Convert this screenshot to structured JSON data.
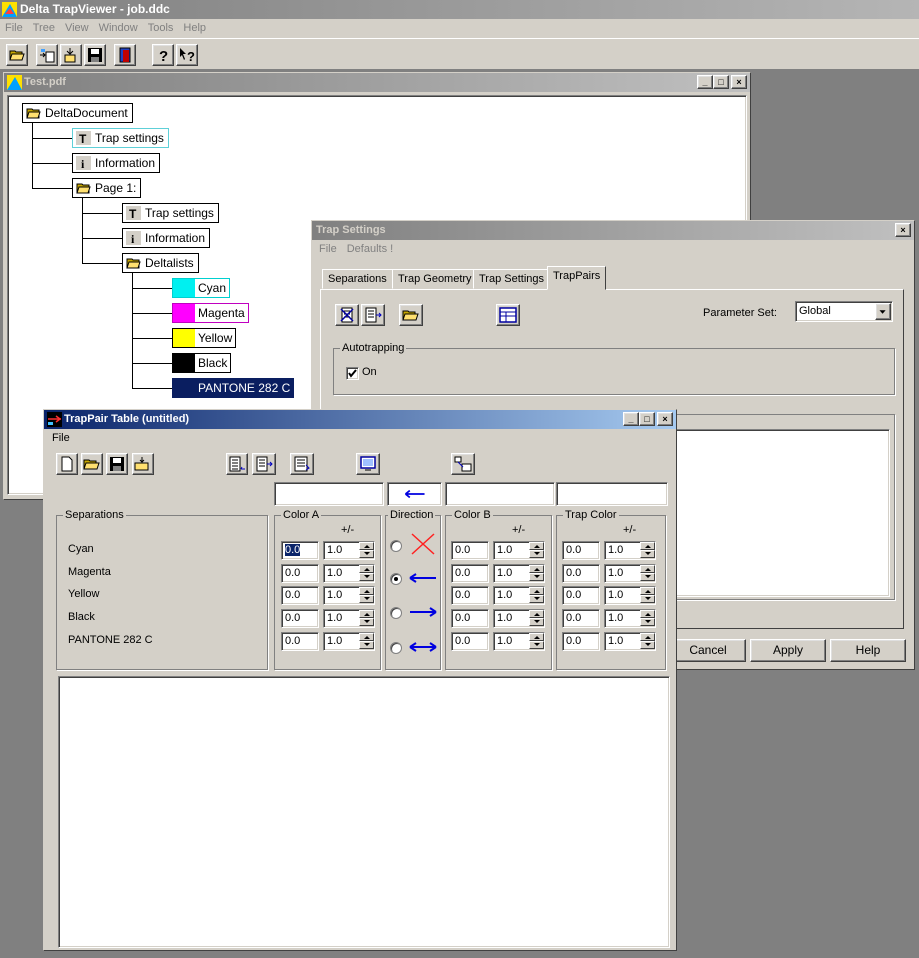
{
  "app": {
    "title": "Delta TrapViewer - job.ddc",
    "menu": [
      "File",
      "Tree",
      "View",
      "Window",
      "Tools",
      "Help"
    ]
  },
  "doc_window": {
    "title": "Test.pdf",
    "tree": {
      "root": "DeltaDocument",
      "trap_settings": "Trap settings",
      "information": "Information",
      "page": "Page 1:",
      "page_trap_settings": "Trap settings",
      "page_information": "Information",
      "deltalists": "Deltalists",
      "colors": [
        {
          "label": "Cyan",
          "swatch": "#00f0f0",
          "border": "#00d0d0"
        },
        {
          "label": "Magenta",
          "swatch": "#ff00ff",
          "border": "#c000c0"
        },
        {
          "label": "Yellow",
          "swatch": "#ffff00",
          "border": "#000000"
        },
        {
          "label": "Black",
          "swatch": "#000000",
          "border": "#000000"
        },
        {
          "label": "PANTONE 282 C",
          "swatch": "#0a1e60",
          "border": "#0a1e60"
        }
      ]
    }
  },
  "trap_settings": {
    "title": "Trap Settings",
    "menu": [
      "File",
      "Defaults !"
    ],
    "tabs": [
      "Separations",
      "Trap Geometry",
      "Trap Settings",
      "TrapPairs"
    ],
    "parameter_set_label": "Parameter Set:",
    "parameter_set_value": "Global",
    "autotrapping_label": "Autotrapping",
    "on_label": "On",
    "buttons": {
      "cancel": "Cancel",
      "apply": "Apply",
      "help": "Help"
    }
  },
  "trappair": {
    "title": "TrapPair Table  (untitled)",
    "menu": [
      "File"
    ],
    "separations_label": "Separations",
    "color_a_label": "Color A",
    "direction_label": "Direction",
    "color_b_label": "Color B",
    "trap_color_label": "Trap Color",
    "plus_minus": "+/-",
    "rows": [
      {
        "name": "Cyan",
        "a_val": "0.0",
        "a_tol": "1.0",
        "b_val": "0.0",
        "b_tol": "1.0",
        "t_val": "0.0",
        "t_tol": "1.0"
      },
      {
        "name": "Magenta",
        "a_val": "0.0",
        "a_tol": "1.0",
        "b_val": "0.0",
        "b_tol": "1.0",
        "t_val": "0.0",
        "t_tol": "1.0"
      },
      {
        "name": "Yellow",
        "a_val": "0.0",
        "a_tol": "1.0",
        "b_val": "0.0",
        "b_tol": "1.0",
        "t_val": "0.0",
        "t_tol": "1.0"
      },
      {
        "name": "Black",
        "a_val": "0.0",
        "a_tol": "1.0",
        "b_val": "0.0",
        "b_tol": "1.0",
        "t_val": "0.0",
        "t_tol": "1.0"
      },
      {
        "name": "PANTONE 282 C",
        "a_val": "0.0",
        "a_tol": "1.0",
        "b_val": "0.0",
        "b_tol": "1.0",
        "t_val": "0.0",
        "t_tol": "1.0"
      }
    ],
    "direction_options": [
      "none-x-icon",
      "arrow-left-icon",
      "arrow-right-icon",
      "arrow-both-icon"
    ],
    "selected_direction": 1
  }
}
